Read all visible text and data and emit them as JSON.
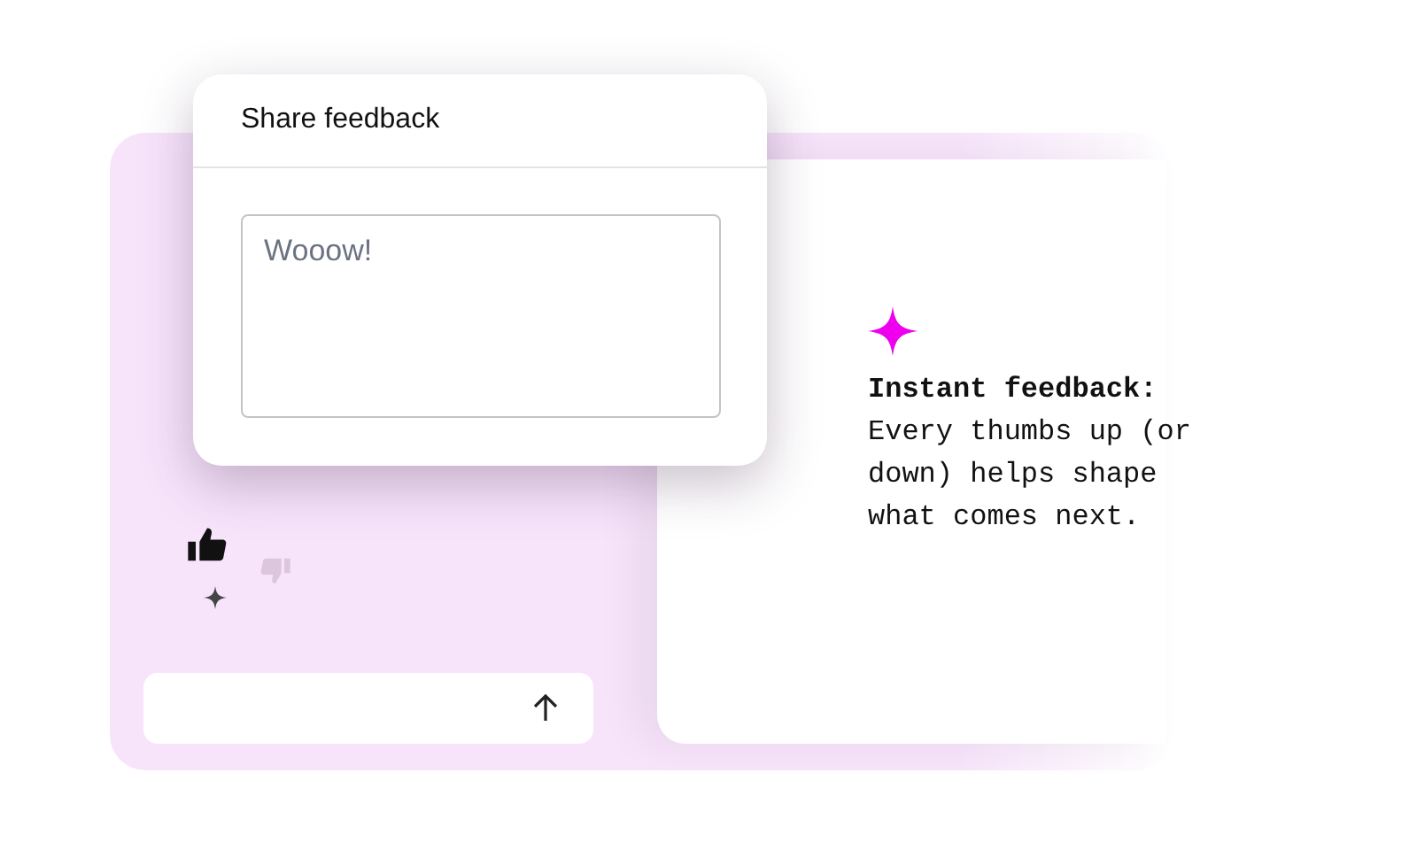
{
  "popup": {
    "title": "Share feedback",
    "field": {
      "placeholder": "Wooow!"
    }
  },
  "reactions": [
    {
      "kind": "up",
      "selected": true
    },
    {
      "kind": "down",
      "selected": false
    }
  ],
  "caption": "**Instant feedback:** Every thumbs up (or down) helps shape what comes next."
}
